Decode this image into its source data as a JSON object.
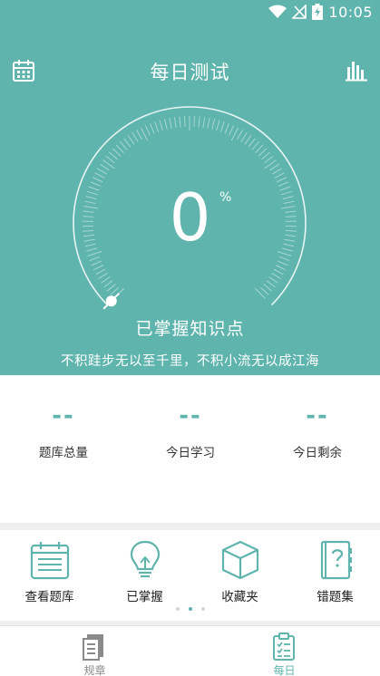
{
  "status": {
    "time": "10:05",
    "icons": [
      "wifi-icon",
      "no-signal-icon",
      "battery-charging-icon"
    ]
  },
  "header": {
    "title": "每日测试",
    "left_icon": "calendar-icon",
    "right_icon": "bar-chart-icon"
  },
  "progress": {
    "value": "0",
    "unit": "%",
    "fraction": 0,
    "label": "已掌握知识点"
  },
  "motto": "不积跬步无以至千里，不积小流无以成江海",
  "stats": [
    {
      "value": "--",
      "label": "题库总量"
    },
    {
      "value": "--",
      "label": "今日学习"
    },
    {
      "value": "--",
      "label": "今日剩余"
    }
  ],
  "menu": [
    {
      "label": "查看题库",
      "icon": "question-bank-icon"
    },
    {
      "label": "已掌握",
      "icon": "lightbulb-icon"
    },
    {
      "label": "收藏夹",
      "icon": "box-icon"
    },
    {
      "label": "错题集",
      "icon": "notebook-icon"
    }
  ],
  "pager": {
    "count": 3,
    "active": 1
  },
  "tabs": [
    {
      "label": "规章",
      "icon": "document-icon",
      "active": false
    },
    {
      "label": "每日",
      "icon": "clipboard-checklist-icon",
      "active": true
    }
  ],
  "colors": {
    "accent": "#5fb5ad",
    "tab_inactive": "#8a8a8a",
    "background": "#efefef"
  }
}
